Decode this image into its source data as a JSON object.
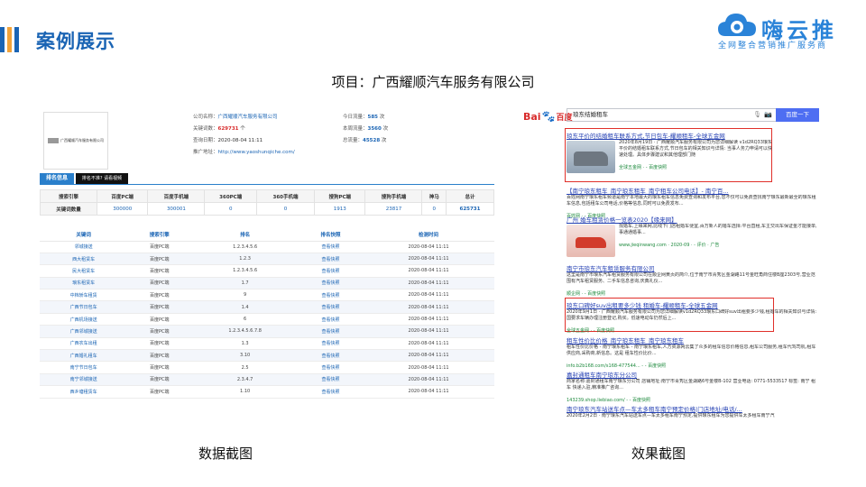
{
  "page": {
    "title": "案例展示",
    "project": "项目：广西耀顺汽车服务有限公司",
    "bar_colors": [
      "#1a64b4",
      "#f2a33a",
      "#1a64b4"
    ]
  },
  "logo": {
    "name": "嗨云推",
    "slogan": "全网整合营销推广服务商"
  },
  "captions": {
    "left": "数据截图",
    "right": "效果截图"
  },
  "data_shot": {
    "company_logo_text": "广西耀顺汽车服务有限公司",
    "company_label": "公司名称：",
    "company_value": "广西耀顺汽车服务有限公司",
    "keywords_label": "关键词数：",
    "keywords_value": "629731",
    "keywords_unit": "个",
    "query_date_label": "查询日期：",
    "query_date_value": "2020-08-04 11:11",
    "url_label": "推广地址：",
    "url_value": "http://www.yaoshunqiche.com/",
    "today_label": "今日流量：",
    "today_value": "585",
    "week_label": "本周流量：",
    "week_value": "3560",
    "total_label": "总流量：",
    "total_value": "45528",
    "unit_ci": "次",
    "tab_ranking": "排名信息",
    "tab_dissatisfied": "排名不准? 请看视频",
    "summary_headers": [
      "搜索引擎",
      "百度PC端",
      "百度手机端",
      "360PC端",
      "360手机端",
      "搜狗PC端",
      "搜狗手机端",
      "神马",
      "总计"
    ],
    "summary_row": [
      "关键词数量",
      "300000",
      "300001",
      "0",
      "0",
      "1913",
      "23817",
      "0",
      "625731"
    ],
    "detail_headers": [
      "关键词",
      "搜索引擎",
      "排名",
      "排名快照",
      "检测时间"
    ],
    "detail_rows": [
      [
        "邻城接送",
        "百度PC端",
        "1.2.3.4.5.6",
        "查看快照",
        "2020-08-04 11:11"
      ],
      [
        "西大租赁车",
        "百度PC端",
        "1.2.3",
        "查看快照",
        "2020-08-04 11:11"
      ],
      [
        "民大租赁车",
        "百度PC端",
        "1.2.3.4.5.6",
        "查看快照",
        "2020-08-04 11:11"
      ],
      [
        "琅东租赁车",
        "百度PC端",
        "1.7",
        "查看快照",
        "2020-08-04 11:11"
      ],
      [
        "中档轿车租赁",
        "百度PC端",
        "9",
        "查看快照",
        "2020-08-04 11:11"
      ],
      [
        "广西节日包车",
        "百度PC端",
        "1.4",
        "查看快照",
        "2020-08-04 11:11"
      ],
      [
        "广西机场接送",
        "百度PC端",
        "6",
        "查看快照",
        "2020-08-04 11:11"
      ],
      [
        "广西邻城接送",
        "百度PC端",
        "1.2.3.4.5.6.7.8",
        "查看快照",
        "2020-08-04 11:11"
      ],
      [
        "广西农车出租",
        "百度PC端",
        "1.3",
        "查看快照",
        "2020-08-04 11:11"
      ],
      [
        "广西婚礼租车",
        "百度PC端",
        "3.10",
        "查看快照",
        "2020-08-04 11:11"
      ],
      [
        "南宁节日包车",
        "百度PC端",
        "2.5",
        "查看快照",
        "2020-08-04 11:11"
      ],
      [
        "南宁邻城接送",
        "百度PC端",
        "2.3.4.7",
        "查看快照",
        "2020-08-04 11:11"
      ],
      [
        "西乡塘租赁车",
        "百度PC端",
        "1.10",
        "查看快照",
        "2020-08-04 11:11"
      ]
    ]
  },
  "result_shot": {
    "baidu_logo": "Bai",
    "baidu_logo_cn": "百度",
    "query": "琅东结婚租车",
    "search_button": "百度一下",
    "results": [
      {
        "title": "琅东平价的结婚租车联系方式,节日包车-耀顺租车-全球五金网",
        "desc": "2020年8月19日 · 广西耀顺汽车服务有限公司为您详细解读 v1d2RQ33琅东平价的结婚租车联系方式,节日包车的相关知识与详情: 当事人务力申请可以快速处理。具体步骤建议和其他理部门随",
        "url": "全球五金网 ·  - 百度快照"
      },
      {
        "title": "【南宁琅东租车_南宁琅东租车_南宁租车公司电话】- 南宁百...",
        "desc": "百姓网南宁琅东租车频道是南宁本地最大的琅东租车信息免费查询和发布平台,您不仅可以免费查找南宁琅东最新最全的琅东租车信息,包括租车公司电话,价格等信息,同时可以免费发布...",
        "url": "百姓网 ·  - 百度快照"
      },
      {
        "title": "广州 婚车租赁价格一览表2020【缘来网】",
        "desc": "找婚车,上缘来网,比线下门店租婚车便宜,百万新人的婚车选择:平台直租,车主交出车保证金才能接单,事通通婚事...",
        "url": "www.jieqinwang.com · 2020-09 ·  - 评价 · 广告"
      },
      {
        "title": "南宁市琅东汽车租赁服务有限公司",
        "desc": "这里是南宁市琅东汽车租赁服务有限公司在顺企网黄页的简介,位于南宁市青秀区金湖路11号金旺角商住楼B座2303号,营业范围有汽车租赁服务、二手车信息咨询,庆典礼仪...",
        "url": "顺企网 ·  - 百度快照"
      },
      {
        "title": "琅东口碑好suv出租要多少钱 租婚车-耀顺租车-全球五金网",
        "desc": "2020年9月1日 · 广西耀顺汽车服务有限公司为您详细解读v1d2RQ33琅东口碑好suv出租要多少钱,租婚车的相关知识与详情:国要求车辆办理注册登记,购买。低速电动车仍然后上...",
        "url": "全球五金网 ·  - 百度快照"
      },
      {
        "title": "租车性价比价格_南宁琅东租车_南宁琅东租车",
        "desc": "租车性价比价格 - 南宁琅东租车 - 南宁琅东租车,人方资源网云集了众多的租车信息价格信息,租车公司服务,租车代驾司机,租车供应商,采购商,新信息。这是 租车性价比价...",
        "url": "info.b2b168.com/s168-477544... -  - 百度快照"
      },
      {
        "title": "嘉封通租车南宁琅东分公司",
        "desc": "商家名称:嘉封通租车南宁琅东分公司 店铺地址:南宁市青秀区金湖路6号金楼B-102 营业电话: 0771-5533517 标签: 南宁 租车 快递入驻,精准推广咨询...",
        "url": "143239.shop.liebiao.com/ -  - 百度快照"
      },
      {
        "title": "南宁琅东汽车站送车点—车太多租车南宁预定价格|门店地址/电话/...",
        "desc": "2020年2月2日 · 南宁琅东汽车站送车点—车太多租车南宁预定,提供琅东租车为您提供车太多租车南宁汽",
        "url": ""
      }
    ]
  }
}
